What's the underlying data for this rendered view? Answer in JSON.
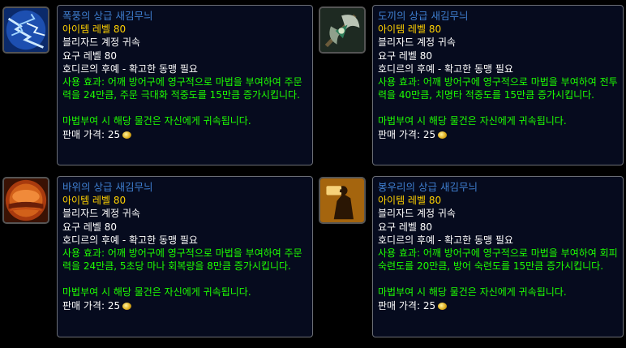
{
  "common": {
    "item_level": "아이템 레벨 80",
    "binding": "블리자드 계정 귀속",
    "required_level": "요구 레벨 80",
    "reputation": "호디르의 후예 - 확고한 동맹 필요",
    "bind_note": "마법부여 시 해당 물건은 자신에게 귀속됩니다.",
    "sell_price": "판매 가격: 25"
  },
  "items": [
    {
      "title": "폭풍의 상급 새김무늬",
      "use_effect": "사용 효과: 어깨 방어구에 영구적으로 마법을 부여하여 주문력을 24만큼, 주문 극대화 적중도를 15만큼 증가시킵니다.",
      "icon": "lightning-icon"
    },
    {
      "title": "도끼의 상급 새김무늬",
      "use_effect": "사용 효과: 어깨 방어구에 영구적으로 마법을 부여하여 전투력을 40만큼, 치명타 적중도를 15만큼 증가시킵니다.",
      "icon": "axe-icon"
    },
    {
      "title": "바위의 상급 새김무늬",
      "use_effect": "사용 효과: 어깨 방어구에 영구적으로 마법을 부여하여 주문력을 24만큼, 5초당 마나 회복량을 8만큼 증가시킵니다.",
      "icon": "sun-icon"
    },
    {
      "title": "봉우리의 상급 새김무늬",
      "use_effect": "사용 효과: 어깨 방어구에 영구적으로 마법을 부여하여 회피 숙련도를 20만큼, 방어 숙련도를 15만큼 증가시킵니다.",
      "icon": "shield-warrior-icon"
    }
  ]
}
